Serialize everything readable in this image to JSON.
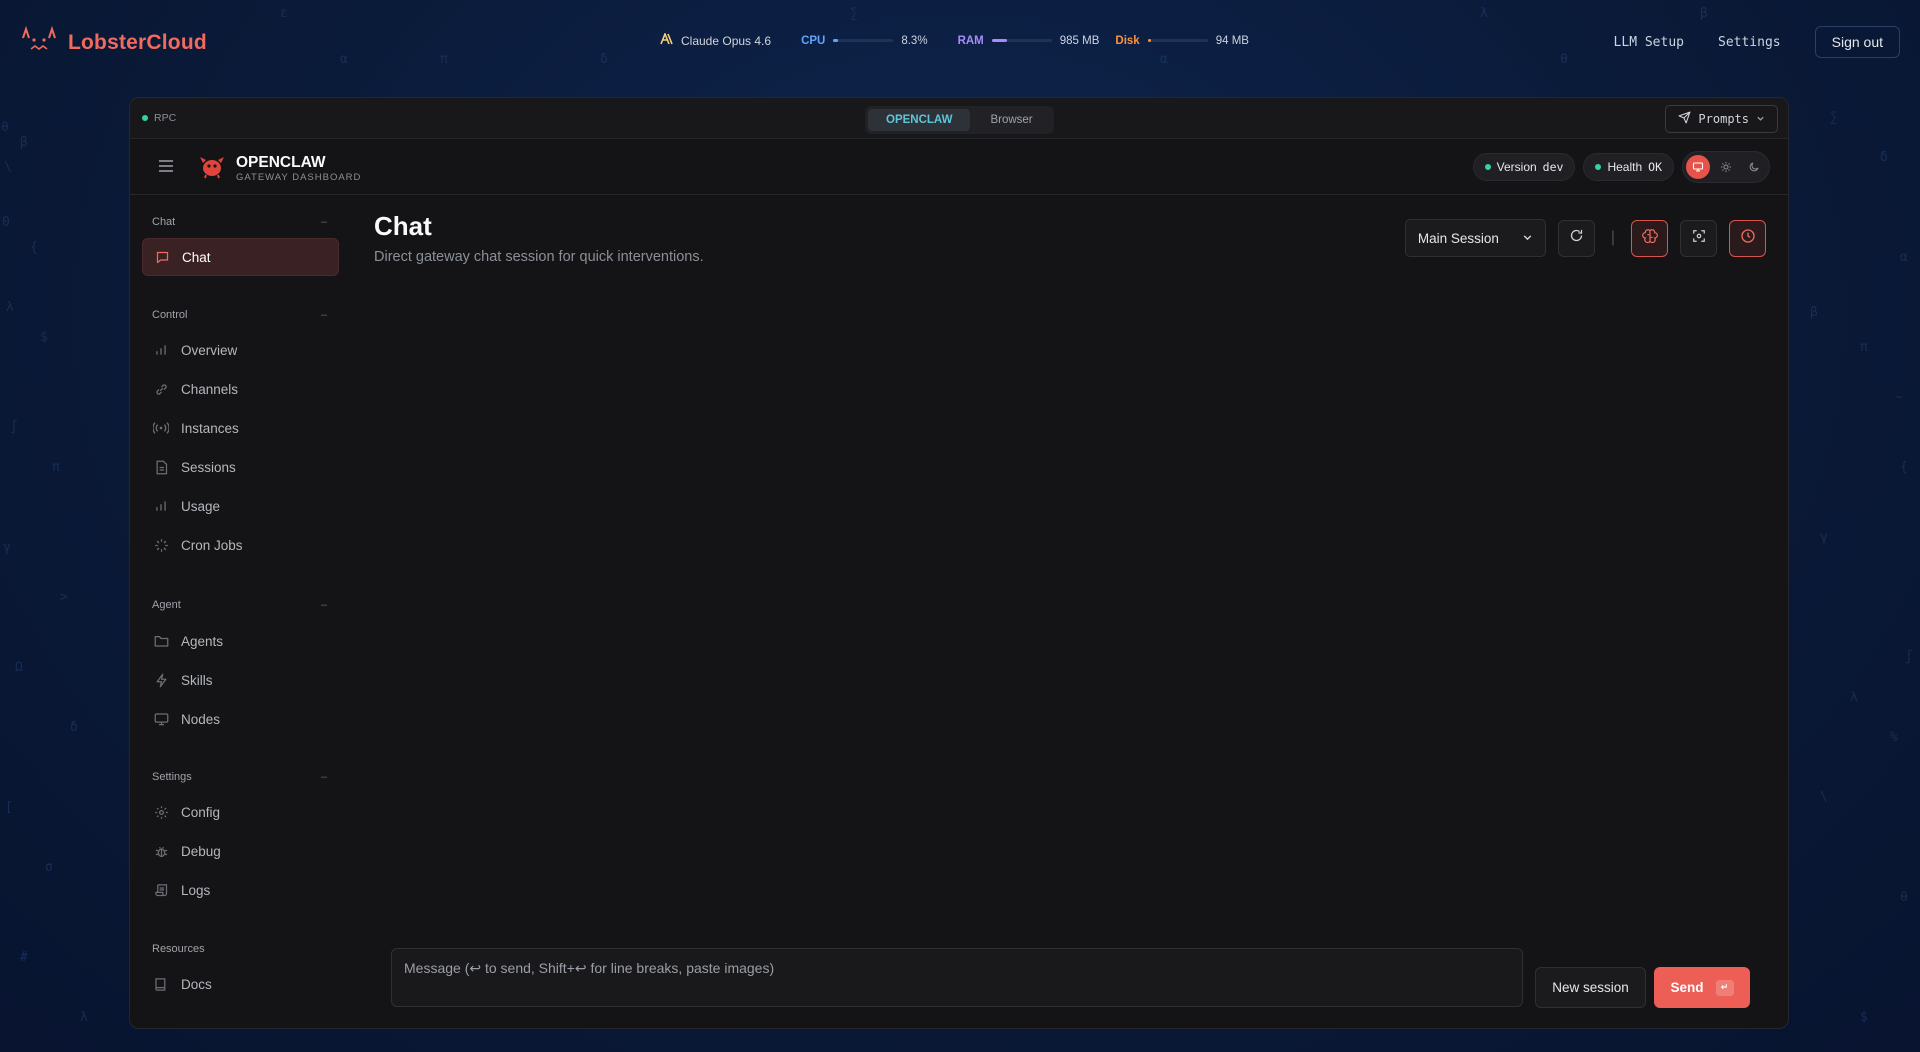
{
  "brand": {
    "name": "LobsterCloud",
    "logo_icon": "lobster-face-icon"
  },
  "status_bar": {
    "model": "Claude Opus 4.6",
    "cpu": {
      "label": "CPU",
      "value": "8.3%",
      "fraction": 0.083,
      "color": "#60a5fa"
    },
    "ram": {
      "label": "RAM",
      "value": "985 MB",
      "fraction": 0.25,
      "color": "#a78bfa"
    },
    "disk": {
      "label": "Disk",
      "value": "94 MB",
      "fraction": 0.02,
      "color": "#fb923c"
    }
  },
  "top_links": {
    "llm_setup": "LLM Setup",
    "settings": "Settings",
    "sign_out": "Sign out"
  },
  "window": {
    "rpc_label": "RPC",
    "tabs": [
      {
        "label": "OPENCLAW",
        "active": true
      },
      {
        "label": "Browser",
        "active": false
      }
    ],
    "prompts_label": "Prompts"
  },
  "app": {
    "title": "OPENCLAW",
    "subtitle": "GATEWAY DASHBOARD",
    "version_label": "Version",
    "version_value": "dev",
    "health_label": "Health",
    "health_value": "OK"
  },
  "sidebar": {
    "sections": [
      {
        "title": "Chat",
        "items": [
          {
            "label": "Chat",
            "icon": "message-icon",
            "active": true
          }
        ]
      },
      {
        "title": "Control",
        "items": [
          {
            "label": "Overview",
            "icon": "bar-chart-icon"
          },
          {
            "label": "Channels",
            "icon": "link-icon"
          },
          {
            "label": "Instances",
            "icon": "radio-icon"
          },
          {
            "label": "Sessions",
            "icon": "file-icon"
          },
          {
            "label": "Usage",
            "icon": "bar-chart-icon"
          },
          {
            "label": "Cron Jobs",
            "icon": "loader-icon"
          }
        ]
      },
      {
        "title": "Agent",
        "items": [
          {
            "label": "Agents",
            "icon": "folder-icon"
          },
          {
            "label": "Skills",
            "icon": "bolt-icon"
          },
          {
            "label": "Nodes",
            "icon": "monitor-icon"
          }
        ]
      },
      {
        "title": "Settings",
        "items": [
          {
            "label": "Config",
            "icon": "gear-icon"
          },
          {
            "label": "Debug",
            "icon": "bug-icon"
          },
          {
            "label": "Logs",
            "icon": "scroll-icon"
          }
        ]
      },
      {
        "title": "Resources",
        "items": [
          {
            "label": "Docs",
            "icon": "book-icon"
          }
        ]
      }
    ]
  },
  "main": {
    "title": "Chat",
    "subtitle": "Direct gateway chat session for quick interventions.",
    "session_select": "Main Session",
    "composer_placeholder": "Message (↩ to send, Shift+↩ for line breaks, paste images)",
    "new_session_label": "New session",
    "send_label": "Send",
    "send_key": "↵"
  }
}
